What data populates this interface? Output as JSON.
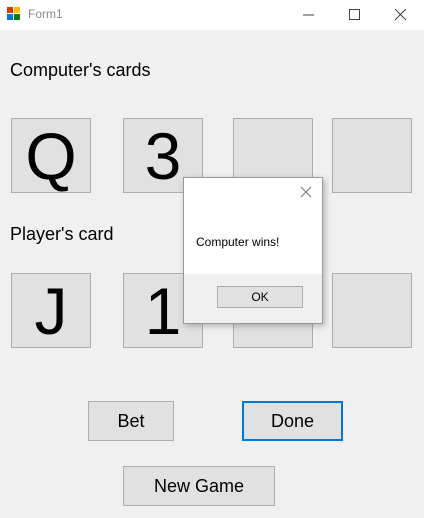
{
  "window": {
    "title": "Form1",
    "icon": "winforms-app-icon",
    "controls": [
      "minimize-icon",
      "maximize-icon",
      "close-icon"
    ]
  },
  "computer": {
    "label": "Computer's cards",
    "cards": [
      "Q",
      "3",
      "",
      ""
    ]
  },
  "player": {
    "label": "Player's card",
    "cards": [
      "J",
      "1",
      "",
      ""
    ]
  },
  "buttons": {
    "bet": "Bet",
    "done": "Done",
    "new_game": "New Game"
  },
  "dialog": {
    "message": "Computer wins!",
    "ok": "OK",
    "close_icon": "close-icon"
  },
  "colors": {
    "focus_border": "#0078d7",
    "window_bg": "#f0f0f0",
    "card_bg": "#e1e1e1"
  }
}
